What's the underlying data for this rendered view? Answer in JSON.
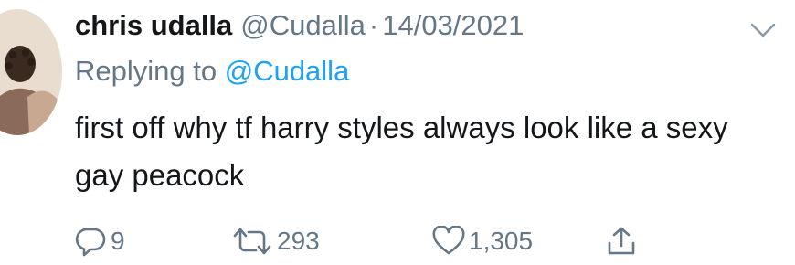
{
  "tweet": {
    "display_name": "chris udalla",
    "handle": "@Cudalla",
    "separator": "·",
    "date": "14/03/2021",
    "replying_prefix": "Replying to",
    "replying_to": "@Cudalla",
    "text": "first off why tf harry styles always look like a sexy gay peacock"
  },
  "actions": {
    "reply_count": "9",
    "retweet_count": "293",
    "like_count": "1,305"
  },
  "icons": {
    "reply": "reply-icon",
    "retweet": "retweet-icon",
    "like": "heart-icon",
    "share": "share-icon",
    "caret": "chevron-down-icon"
  },
  "colors": {
    "name": "#14171a",
    "secondary": "#657786",
    "link": "#1da1f2"
  }
}
